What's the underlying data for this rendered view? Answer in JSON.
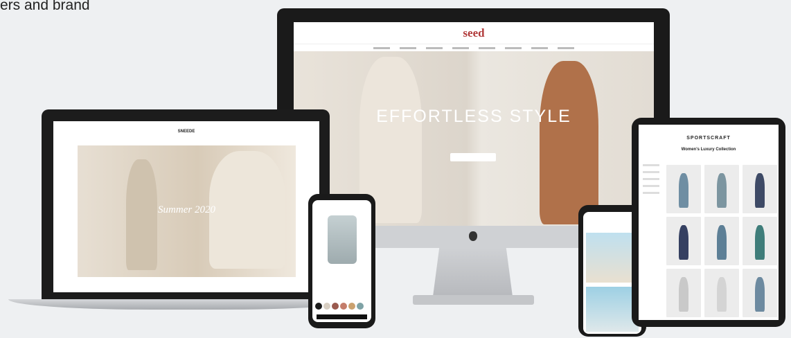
{
  "corner_text": "ers and brand",
  "imac": {
    "brand": "seed",
    "hero_title": "EFFORTLESS STYLE"
  },
  "laptop": {
    "brand": "SNEEDE",
    "hero_caption": "Summer 2020"
  },
  "tablet": {
    "brand": "SPORTSCRAFT",
    "collection_title": "Women's Luxury Collection"
  },
  "colors": {
    "seed_red": "#b13a3a",
    "frame": "#1a1a1a",
    "bg": "#eef0f2"
  },
  "phone_left": {
    "swatch_colors": [
      "#1b1b1b",
      "#d8cfc3",
      "#9a5a4f",
      "#c47d6b",
      "#caa16f",
      "#7fa3a6"
    ]
  }
}
